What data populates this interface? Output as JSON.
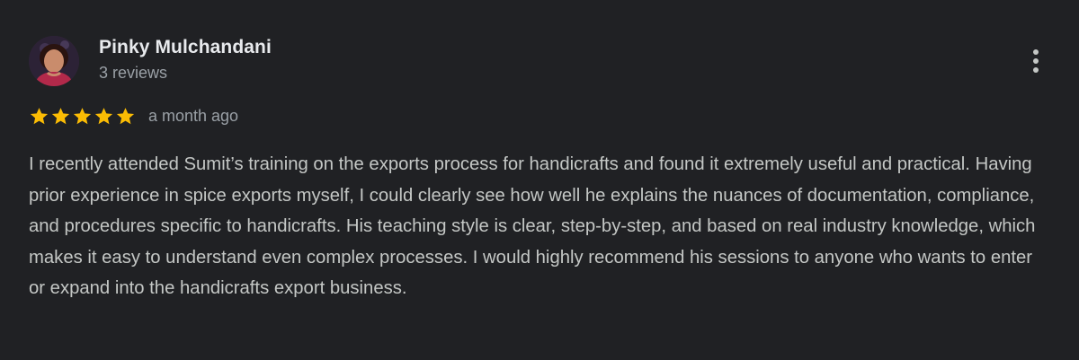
{
  "review": {
    "author": {
      "name": "Pinky Mulchandani",
      "reviews_count": "3 reviews",
      "avatar_icon": "profile-photo"
    },
    "rating": {
      "stars": 5,
      "max": 5,
      "star_color": "#fbbc04"
    },
    "date": "a month ago",
    "text": "I recently attended Sumit’s training on the exports process for handicrafts and found it extremely useful and practical. Having prior experience in spice exports myself, I could clearly see how well he explains the nuances of documentation, compliance, and procedures specific to handicrafts. His teaching style is clear, step-by-step, and based on real industry knowledge, which makes it easy to understand even complex processes. I would highly recommend his sessions to anyone who wants to enter or expand into the handicrafts export business.",
    "more_icon": "more-vert-icon"
  },
  "theme": {
    "background": "#202124",
    "name_color": "#e8eaed",
    "meta_color": "#9aa0a6",
    "text_color": "#c4c7c5"
  }
}
